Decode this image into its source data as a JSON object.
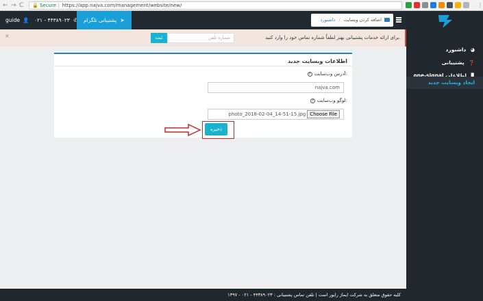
{
  "browser": {
    "nav_back": "←",
    "nav_forward": "→",
    "nav_reload": "C",
    "lock": "🔒",
    "secure": "Secure",
    "url": "https://app.najva.com/management/website/new/"
  },
  "topbar": {
    "user": "guide",
    "phone": "۰۲۱ - ۴۴۳۸۹۰۲۳",
    "telegram": "پشتیبانی تلگرام",
    "breadcrumb_add": "اضافه کردن وبسایت",
    "breadcrumb_sep": "/",
    "breadcrumb_dashboard": "داشبورد"
  },
  "sidebar": {
    "items": [
      {
        "label": "داشبورد",
        "icon": "dashboard-icon",
        "glyph": "◕"
      },
      {
        "label": "پشتیبانی",
        "icon": "help-icon",
        "glyph": "❓"
      },
      {
        "label": "one-signal اطلاعات",
        "icon": "bar-chart-icon",
        "glyph": "▊"
      },
      {
        "label": "ایجاد وبسایت جدید",
        "icon": "",
        "glyph": ""
      }
    ]
  },
  "alert": {
    "close": "×",
    "phone_placeholder": "شماره تلفن",
    "submit": "ثبت",
    "message": "برای ارائه خدمات پشتیبانی بهتر لطفاً شماره تماس خود را وارد کنید."
  },
  "card": {
    "title": "اطلاعات وبسایت جدید",
    "address_label": "آدرس وب‌سایت:",
    "address_value": "najva.com",
    "logo_label": "لوگو وب‌سایت:",
    "file_button": "Choose File",
    "file_name": "photo_2018-02-04_14-51-15.jpg",
    "help_glyph": "?",
    "save": "ذخیره"
  },
  "footer": {
    "text": "۱۳۹۷ - کلیه حقوق متعلق به شرکت ایماژ رایور است | تلفن تماس پشتیبانی : ۴۴۳۸۹۰۲۳ - ۰۲۱"
  },
  "colors": {
    "accent": "#1ab3cf",
    "dark": "#212a31",
    "highlight": "#c32a2a"
  }
}
